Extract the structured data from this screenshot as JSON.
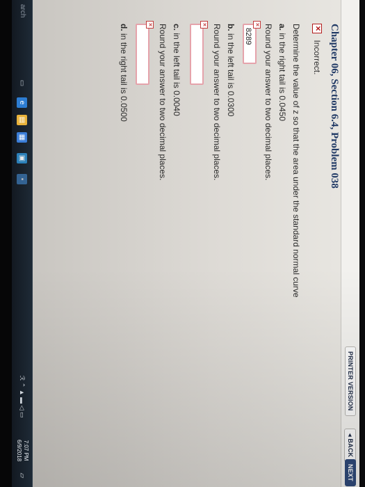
{
  "toolbar": {
    "printer_version": "PRINTER VERSION",
    "back": "◂ BACK",
    "next": "NEXT"
  },
  "problem": {
    "title": "Chapter 06, Section 6.4, Problem 038",
    "status_icon": "x-icon",
    "status": "Incorrect.",
    "instruction": "Determine the value of z so that the area under the standard normal curve",
    "parts": [
      {
        "label": "a.",
        "text": "in the right tail is 0.0450",
        "round": "Round your answer to two decimal places.",
        "answer": "8289",
        "answer_state": "incorrect"
      },
      {
        "label": "b.",
        "text": "in the left tail is 0.0300",
        "round": "Round your answer to two decimal places.",
        "answer": "",
        "answer_state": "incorrect"
      },
      {
        "label": "c.",
        "text": "in the left tail is 0.0040",
        "round": "Round your answer to two decimal places.",
        "answer": "",
        "answer_state": "incorrect"
      },
      {
        "label": "d.",
        "text": "in the right tail is 0.0500",
        "answer": "",
        "answer_state": "incorrect"
      }
    ]
  },
  "taskbar": {
    "search_hint": "arch",
    "clock_time": "7:07 PM",
    "clock_date": "6/9/2018"
  },
  "colors": {
    "title": "#1f3864",
    "error": "#b31b1b",
    "input_border_error": "#e5a3ab",
    "taskbar": "#1e2a36"
  }
}
